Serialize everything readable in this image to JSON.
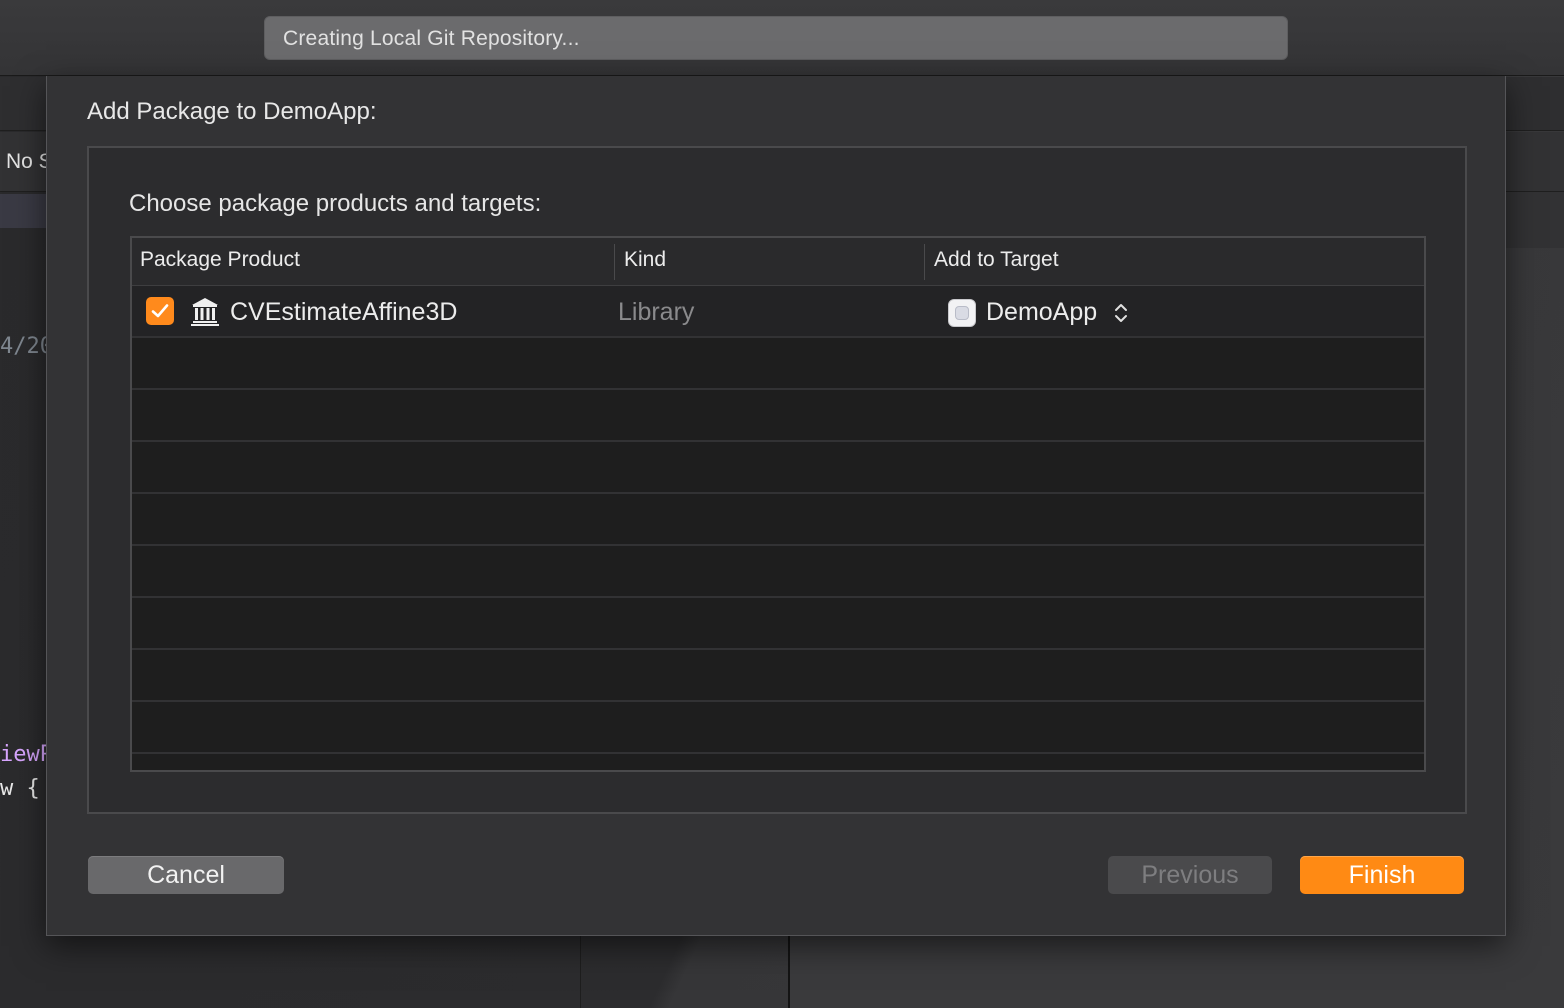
{
  "toolbar": {
    "activity_text": "Creating Local Git Repository..."
  },
  "background": {
    "jumpbar_fragment": "No S",
    "code_date_fragment": "4/20",
    "code_view_fragment": "iewP",
    "code_brace_fragment": "w {"
  },
  "sheet": {
    "title": "Add Package to DemoApp:",
    "subtitle": "Choose package products and targets:",
    "table": {
      "columns": [
        "Package Product",
        "Kind",
        "Add to Target"
      ],
      "rows": [
        {
          "checked": true,
          "icon": "library-building-icon",
          "product": "CVEstimateAffine3D",
          "kind": "Library",
          "target_icon": "app-target-icon",
          "target": "DemoApp"
        }
      ],
      "empty_rows": 8
    },
    "buttons": {
      "cancel": "Cancel",
      "previous": "Previous",
      "finish": "Finish"
    }
  },
  "colors": {
    "accent": "#ff8a14",
    "sheet_bg": "#333335",
    "table_bg": "#1e1e1e"
  }
}
